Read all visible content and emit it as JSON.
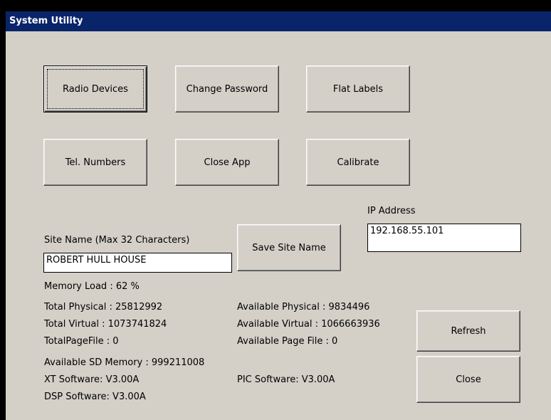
{
  "window": {
    "title": "System Utility"
  },
  "buttons": {
    "radio_devices": "Radio Devices",
    "change_password": "Change Password",
    "flat_labels": "Flat Labels",
    "tel_numbers": "Tel. Numbers",
    "close_app": "Close App",
    "calibrate": "Calibrate",
    "save_site_name": "Save Site Name",
    "refresh": "Refresh",
    "close": "Close"
  },
  "site_name": {
    "label": "Site Name (Max 32 Characters)",
    "value": "ROBERT HULL HOUSE"
  },
  "ip_address": {
    "label": "IP Address",
    "value": "192.168.55.101"
  },
  "stats": {
    "memory_load": "Memory Load : 62 %",
    "total_physical": "Total Physical : 25812992",
    "total_virtual": "Total Virtual : 1073741824",
    "total_page_file": "TotalPageFile : 0",
    "available_physical": "Available Physical : 9834496",
    "available_virtual": "Available Virtual : 1066663936",
    "available_page_file": "Available Page File : 0",
    "available_sd_memory": "Available SD Memory : 999211008",
    "xt_software": "XT Software: V3.00A",
    "dsp_software": "DSP Software: V3.00A",
    "pic_software": "PIC Software: V3.00A"
  },
  "colors": {
    "titlebar": "#0a246a",
    "window_bg": "#d4d0c8"
  }
}
